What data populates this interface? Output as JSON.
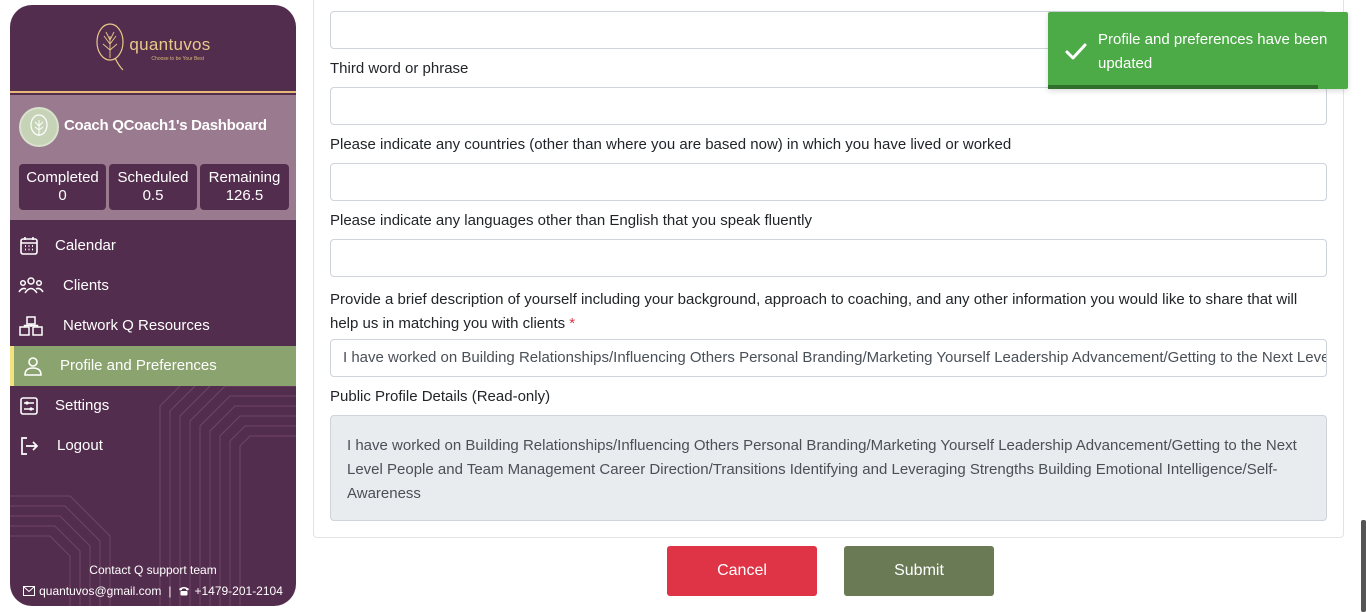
{
  "app": {
    "brand_name": "quantuvos",
    "brand_tagline": "Choose to be Your Best"
  },
  "sidebar": {
    "dashboard_title": "Coach QCoach1's Dashboard",
    "stats": [
      {
        "label": "Completed",
        "value": "0"
      },
      {
        "label": "Scheduled",
        "value": "0.5"
      },
      {
        "label": "Remaining",
        "value": "126.5"
      }
    ],
    "nav": [
      {
        "label": "Calendar",
        "icon": "calendar-icon"
      },
      {
        "label": "Clients",
        "icon": "users-icon"
      },
      {
        "label": "Network Q Resources",
        "icon": "network-icon"
      },
      {
        "label": "Profile and Preferences",
        "icon": "user-icon",
        "active": true
      },
      {
        "label": "Settings",
        "icon": "settings-icon"
      },
      {
        "label": "Logout",
        "icon": "logout-icon"
      }
    ],
    "support": {
      "title": "Contact Q support team",
      "email": "quantuvos@gmail.com",
      "phone": "+1479-201-2104"
    }
  },
  "form": {
    "third_word_label": "Third word or phrase",
    "countries_label": "Please indicate any countries (other than where you are based now) in which you have lived or worked",
    "languages_label": "Please indicate any languages other than English that you speak fluently",
    "description_label": "Provide a brief description of yourself including your background, approach to coaching, and any other information you would like to share that will help us in matching you with clients",
    "required_marker": "*",
    "description_value": "I have worked on Building Relationships/Influencing Others Personal Branding/Marketing Yourself Leadership Advancement/Getting to the Next Level People and Team Management Career Direction/Transitions Identifying and Leveraging Strengths Building Emotional Intelligence/Self-Awareness",
    "public_profile_label": "Public Profile Details (Read-only)",
    "public_profile_value": "I have worked on Building Relationships/Influencing Others Personal Branding/Marketing Yourself Leadership Advancement/Getting to the Next Level People and Team Management Career Direction/Transitions Identifying and Leveraging Strengths Building Emotional Intelligence/Self-Awareness"
  },
  "buttons": {
    "cancel": "Cancel",
    "submit": "Submit"
  },
  "toast": {
    "message": "Profile and preferences have been updated",
    "progress": 0.9
  },
  "colors": {
    "sidebar_bg": "#532d4d",
    "active_nav": "#8aa36f",
    "toast_bg": "#4caa47",
    "cancel_bg": "#df3346",
    "submit_bg": "#697a55"
  }
}
